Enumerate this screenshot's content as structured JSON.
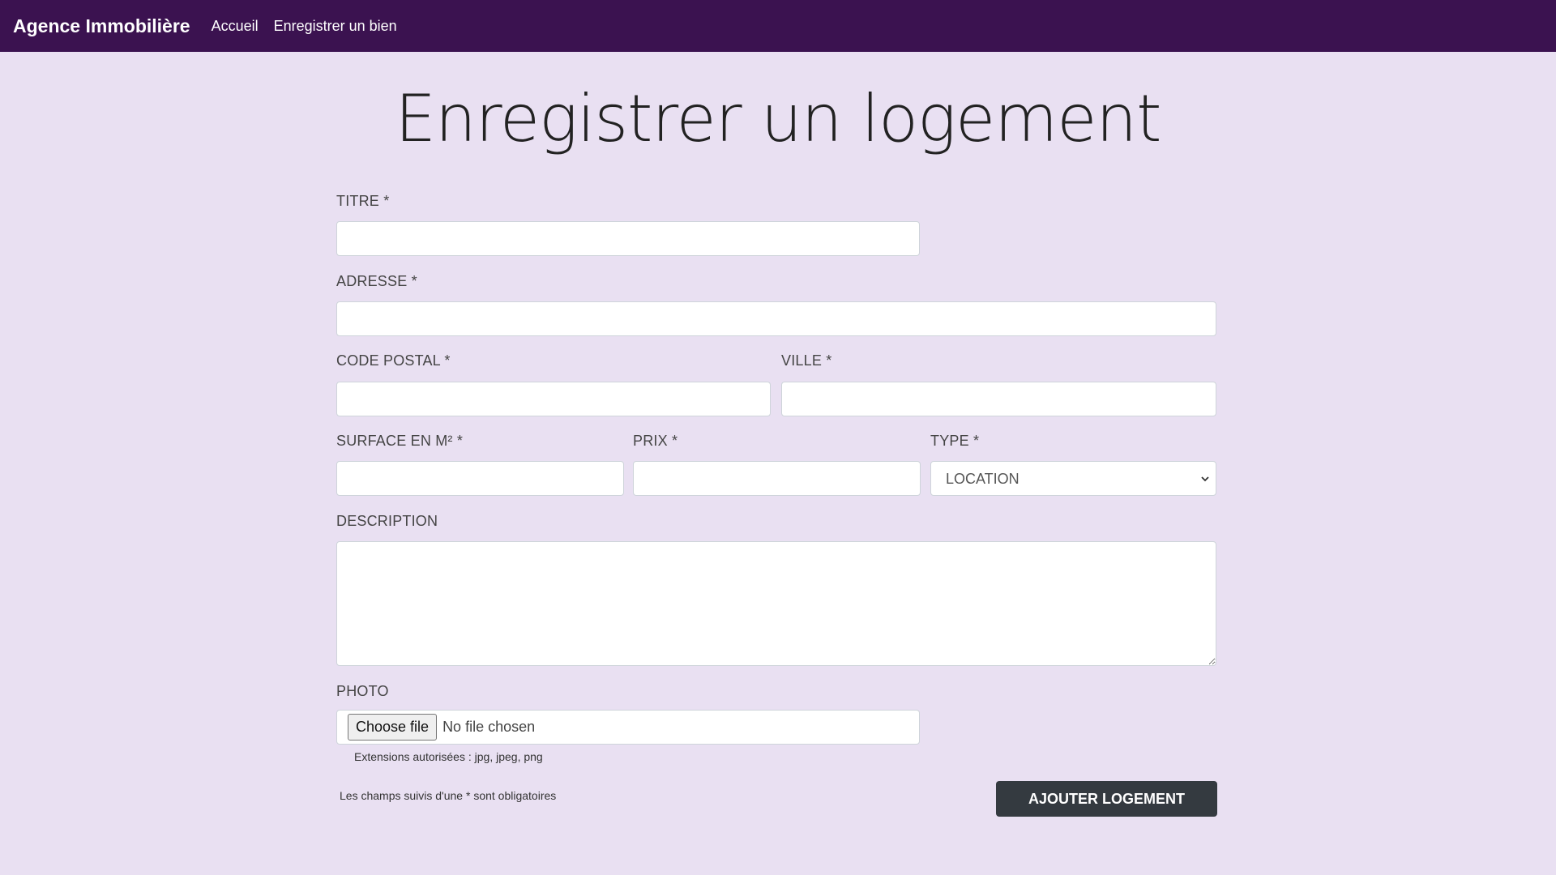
{
  "navbar": {
    "brand": "Agence Immobilière",
    "links": [
      "Accueil",
      "Enregistrer un bien"
    ]
  },
  "page": {
    "title": "Enregistrer un logement"
  },
  "form": {
    "titre_label": "TITRE *",
    "titre_value": "",
    "adresse_label": "ADRESSE *",
    "adresse_value": "",
    "code_postal_label": "CODE POSTAL *",
    "code_postal_value": "",
    "ville_label": "VILLE *",
    "ville_value": "",
    "surface_label": "SURFACE EN M² *",
    "surface_value": "",
    "prix_label": "PRIX *",
    "prix_value": "",
    "type_label": "TYPE *",
    "type_selected": "LOCATION",
    "description_label": "DESCRIPTION",
    "description_value": "",
    "photo_label": "PHOTO",
    "file_button": "Choose file",
    "file_status": "No file chosen",
    "extensions_note": "Extensions autorisées : jpg, jpeg, png",
    "required_note": "Les champs suivis d'une * sont obligatoires",
    "submit_label": "AJOUTER LOGEMENT"
  },
  "icons": {
    "select_arrow": "chevron-down-icon"
  },
  "colors": {
    "navbar_bg": "#3b1250",
    "page_bg": "#e9e0f2",
    "button_bg": "#343a40"
  }
}
